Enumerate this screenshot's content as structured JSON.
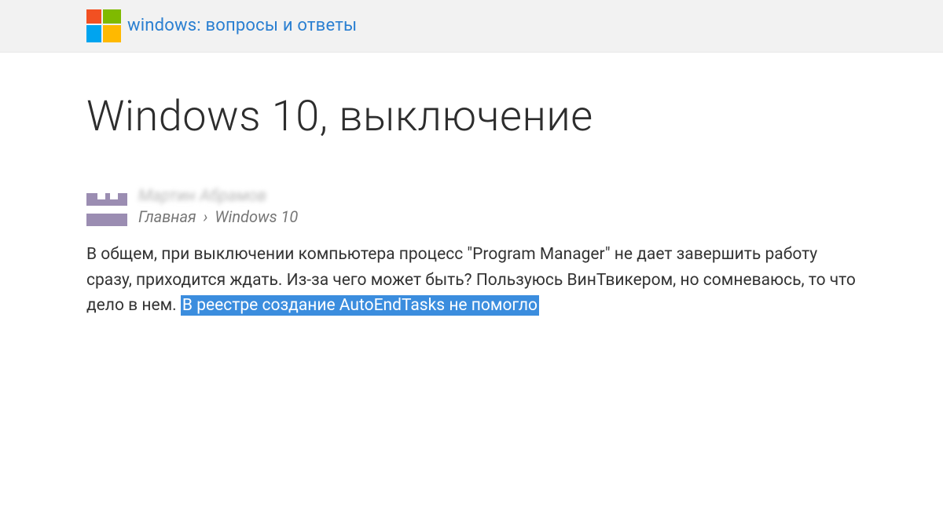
{
  "header": {
    "site_link": "windows: вопросы и ответы"
  },
  "post": {
    "title": "Windows 10, выключение",
    "author": "Мартин Абрамов",
    "breadcrumb": {
      "home": "Главная",
      "sep": "›",
      "category": "Windows 10"
    },
    "body_plain": "В общем, при выключении компьютера процесс \"Program Manager\" не дает завершить работу сразу, приходится ждать. Из-за чего может быть? Пользуюсь ВинТвикером, но сомневаюсь, то что дело в нем. ",
    "body_highlight": "В реестре создание AutoEndTasks не помогло"
  }
}
